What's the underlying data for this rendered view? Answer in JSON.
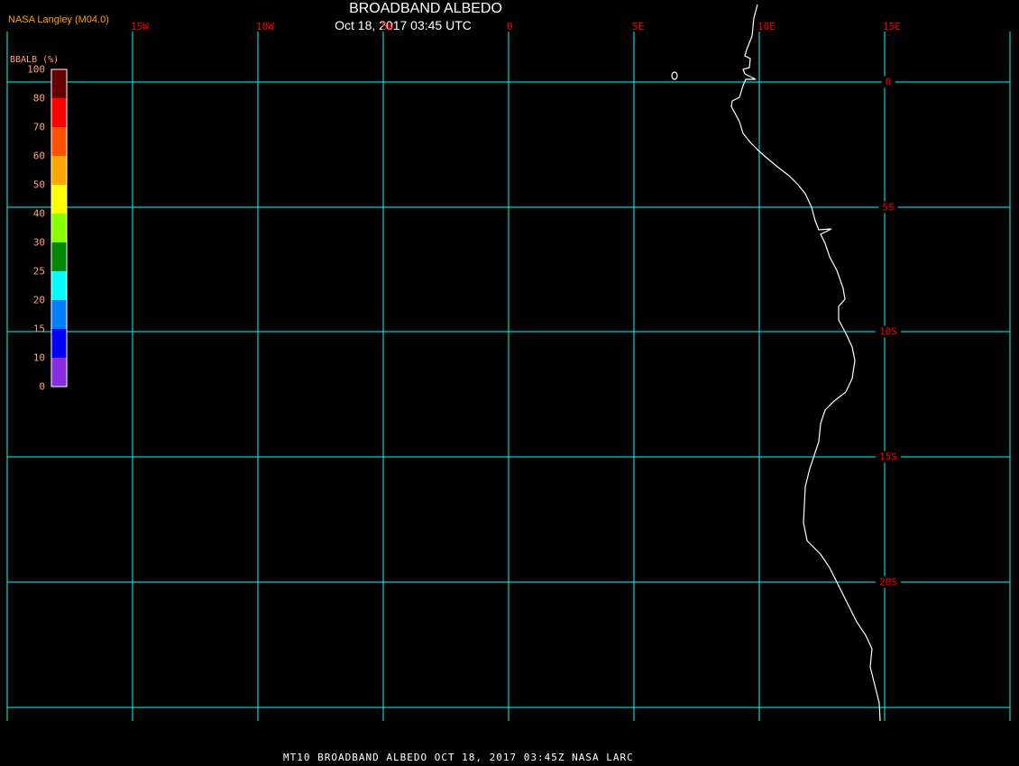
{
  "header": {
    "title": "BROADBAND ALBEDO",
    "subtitle": "Oct 18, 2017 03:45 UTC",
    "org": "NASA Langley (M04.0)"
  },
  "footer": "MT10  BROADBAND ALBEDO   OCT 18, 2017 03:45Z   NASA LARC",
  "grid_color": "#00ffff",
  "label_color": "#ff0000",
  "coast_color": "#ffffff",
  "map": {
    "lon_labels": [
      "15W",
      "10W",
      "5W",
      "0",
      "5E",
      "10E",
      "15E"
    ],
    "lat_labels": [
      "0",
      "5S",
      "10S",
      "15S",
      "20S"
    ]
  },
  "colorbar": {
    "unit_label": "BBALB (%)",
    "ticks": [
      "100",
      "80",
      "70",
      "60",
      "50",
      "40",
      "30",
      "25",
      "20",
      "15",
      "10",
      "0"
    ],
    "colors": [
      "#660000",
      "#ff0000",
      "#ff5000",
      "#ffa500",
      "#ffff00",
      "#88ff00",
      "#008800",
      "#00ffff",
      "#0080ff",
      "#0000ff",
      "#8a2be2"
    ]
  }
}
